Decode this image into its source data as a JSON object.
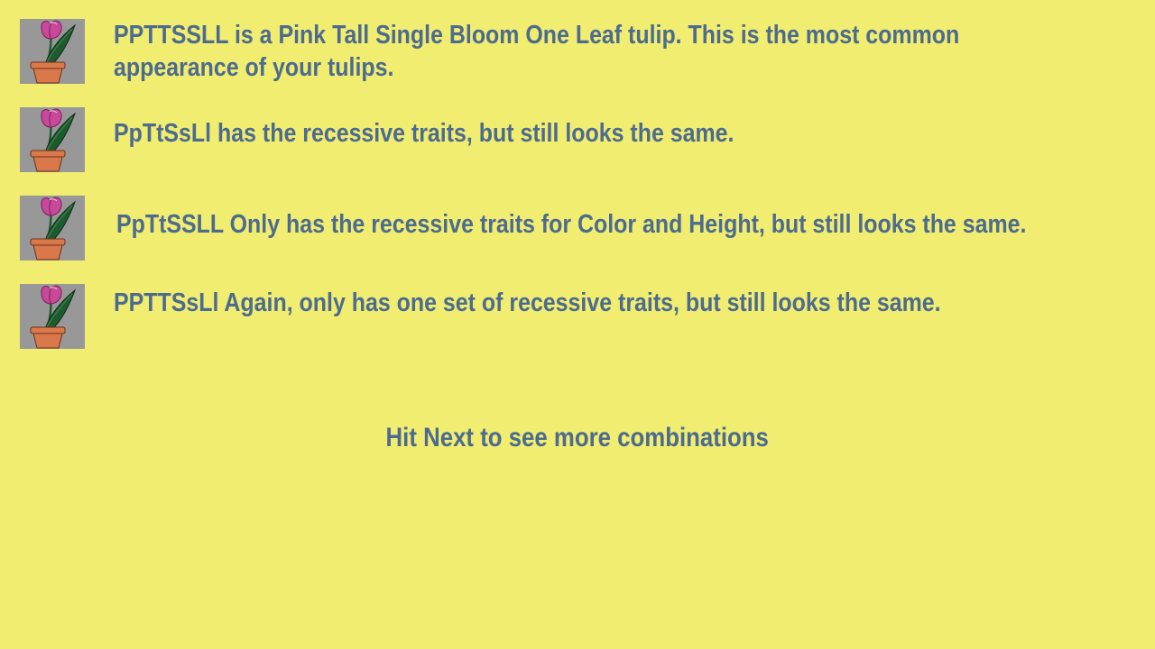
{
  "rows": [
    {
      "line1": "PPTTSSLL is a Pink Tall Single Bloom One Leaf tulip. This is the most common",
      "line2": "appearance of your tulips.",
      "icon": "tulip-pot-icon"
    },
    {
      "text": "PpTtSsLl has the recessive traits, but still looks the same.",
      "icon": "tulip-pot-icon"
    },
    {
      "text": "PpTtSSLL Only has the recessive traits for Color and Height, but still looks the same.",
      "icon": "tulip-pot-icon"
    },
    {
      "text": "PPTTSsLl Again, only has one set of recessive traits, but still looks the same.",
      "icon": "tulip-pot-icon"
    }
  ],
  "footer": "Hit Next to see more combinations",
  "colors": {
    "background": "#f0ed70",
    "text": "#4d6b8f",
    "thumb_bg": "#989898",
    "petal": "#c8489a",
    "leaf": "#1f5a2e",
    "pot": "#d9784a"
  }
}
